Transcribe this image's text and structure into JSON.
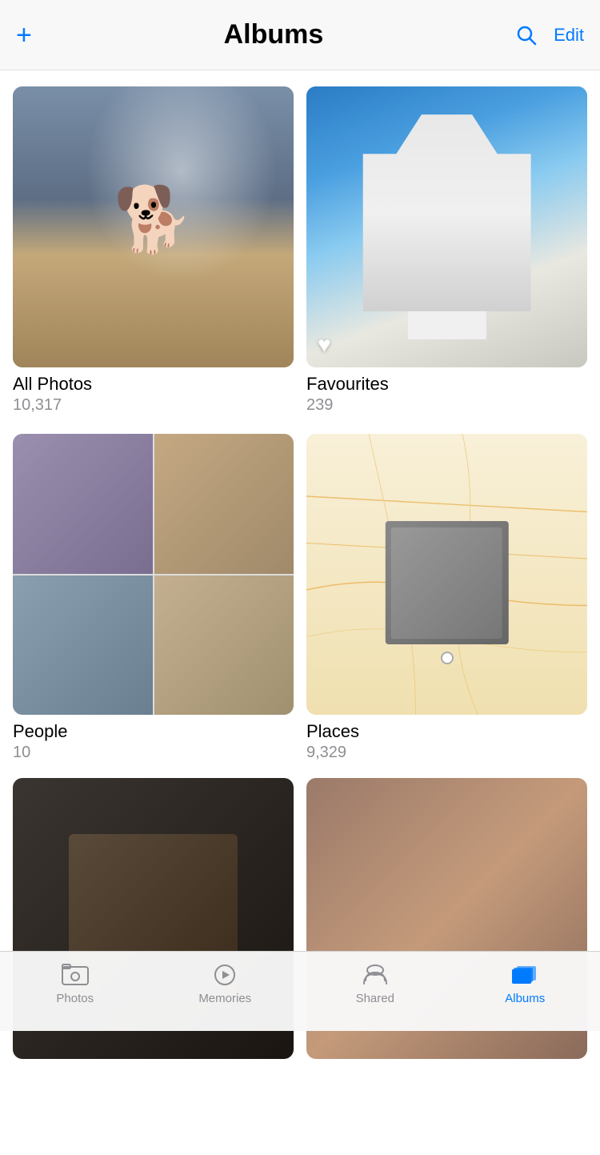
{
  "header": {
    "title": "Albums",
    "add_label": "+",
    "edit_label": "Edit"
  },
  "albums": [
    {
      "id": "all-photos",
      "name": "All Photos",
      "count": "10,317"
    },
    {
      "id": "favourites",
      "name": "Favourites",
      "count": "239"
    },
    {
      "id": "people",
      "name": "People",
      "count": "10"
    },
    {
      "id": "places",
      "name": "Places",
      "count": "9,329"
    }
  ],
  "tabs": [
    {
      "id": "photos",
      "label": "Photos",
      "active": false
    },
    {
      "id": "memories",
      "label": "Memories",
      "active": false
    },
    {
      "id": "shared",
      "label": "Shared",
      "active": false
    },
    {
      "id": "albums",
      "label": "Albums",
      "active": true
    }
  ],
  "colors": {
    "accent": "#007aff",
    "inactive_tab": "#8e8e93"
  }
}
